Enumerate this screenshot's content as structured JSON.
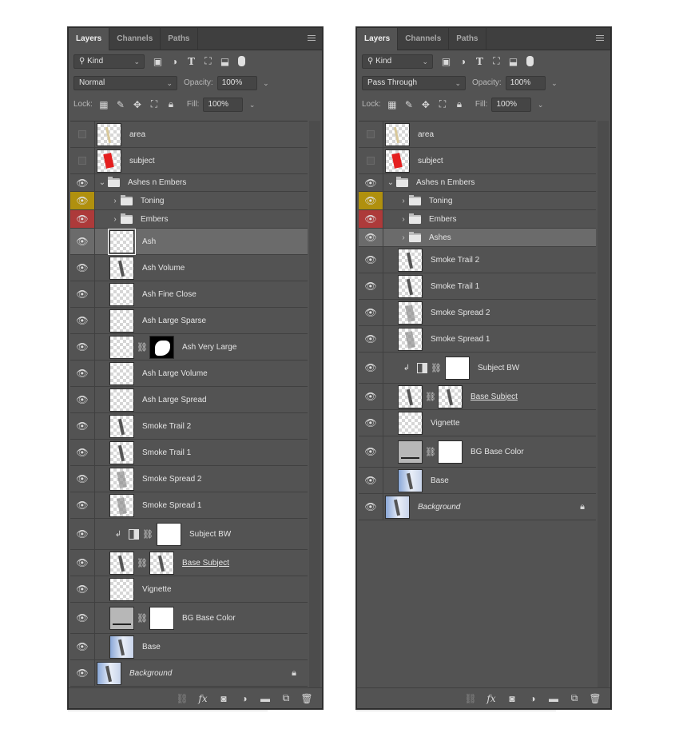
{
  "panels": [
    {
      "id": "left",
      "tabs": [
        "Layers",
        "Channels",
        "Paths"
      ],
      "filter_label": "Kind",
      "blend_mode": "Normal",
      "opacity_label": "Opacity:",
      "opacity_value": "100%",
      "lock_label": "Lock:",
      "fill_label": "Fill:",
      "fill_value": "100%",
      "layers": [
        {
          "name": "area",
          "type": "layer",
          "visible": false,
          "thumb": "tan",
          "indent": 0,
          "h": 33
        },
        {
          "name": "subject",
          "type": "layer",
          "visible": false,
          "thumb": "red",
          "indent": 0,
          "h": 33
        },
        {
          "name": "Ashes n Embers",
          "type": "group-open",
          "visible": true,
          "indent": 0,
          "h": 22
        },
        {
          "name": "Toning",
          "type": "group",
          "visible": true,
          "color": "yellow",
          "indent": 1,
          "h": 23
        },
        {
          "name": "Embers",
          "type": "group",
          "visible": true,
          "color": "red",
          "indent": 1,
          "h": 23
        },
        {
          "name": "Ash",
          "type": "layer",
          "visible": true,
          "thumb": "checker",
          "indent": 1,
          "selected": true,
          "h": 33
        },
        {
          "name": "Ash Volume",
          "type": "layer",
          "visible": true,
          "thumb": "ink",
          "indent": 1,
          "h": 33
        },
        {
          "name": "Ash Fine Close",
          "type": "layer",
          "visible": true,
          "thumb": "checker",
          "indent": 1,
          "h": 33
        },
        {
          "name": "Ash Large Sparse",
          "type": "layer",
          "visible": true,
          "thumb": "checker",
          "indent": 1,
          "h": 33
        },
        {
          "name": "Ash Very Large",
          "type": "masked",
          "visible": true,
          "thumb": "checker",
          "mask": "blob",
          "indent": 1,
          "h": 33
        },
        {
          "name": "Ash Large Volume",
          "type": "layer",
          "visible": true,
          "thumb": "checker",
          "indent": 1,
          "h": 33
        },
        {
          "name": "Ash Large Spread",
          "type": "layer",
          "visible": true,
          "thumb": "checker",
          "indent": 1,
          "h": 33
        },
        {
          "name": "Smoke Trail 2",
          "type": "layer",
          "visible": true,
          "thumb": "ink",
          "indent": 1,
          "h": 33
        },
        {
          "name": "Smoke Trail 1",
          "type": "layer",
          "visible": true,
          "thumb": "ink",
          "indent": 1,
          "h": 33
        },
        {
          "name": "Smoke Spread 2",
          "type": "layer",
          "visible": true,
          "thumb": "smoke",
          "indent": 1,
          "h": 33
        },
        {
          "name": "Smoke Spread 1",
          "type": "layer",
          "visible": true,
          "thumb": "smoke",
          "indent": 1,
          "h": 33
        },
        {
          "name": "Subject BW",
          "type": "adjustment",
          "visible": true,
          "indent": 1,
          "h": 39
        },
        {
          "name": "Base Subject",
          "type": "masked",
          "visible": true,
          "thumb": "ink",
          "mask": "ink",
          "underline": true,
          "indent": 1,
          "h": 33
        },
        {
          "name": "Vignette",
          "type": "layer",
          "visible": true,
          "thumb": "checker",
          "indent": 1,
          "h": 33
        },
        {
          "name": "BG Base Color",
          "type": "masked",
          "visible": true,
          "thumb": "gray",
          "mask": "white",
          "indent": 1,
          "h": 39
        },
        {
          "name": "Base",
          "type": "layer",
          "visible": true,
          "thumb": "photo",
          "indent": 1,
          "h": 33
        },
        {
          "name": "Background",
          "type": "layer",
          "visible": true,
          "thumb": "photo",
          "italic": true,
          "locked": true,
          "indent": 0,
          "h": 33
        }
      ],
      "footer_icons": [
        "link-icon",
        "fx-icon",
        "mask-icon",
        "adjustment-icon",
        "folder-icon",
        "new-layer-icon",
        "trash-icon"
      ]
    },
    {
      "id": "right",
      "tabs": [
        "Layers",
        "Channels",
        "Paths"
      ],
      "filter_label": "Kind",
      "blend_mode": "Pass Through",
      "opacity_label": "Opacity:",
      "opacity_value": "100%",
      "lock_label": "Lock:",
      "fill_label": "Fill:",
      "fill_value": "100%",
      "layers": [
        {
          "name": "area",
          "type": "layer",
          "visible": false,
          "thumb": "tan",
          "indent": 0,
          "h": 33
        },
        {
          "name": "subject",
          "type": "layer",
          "visible": false,
          "thumb": "red",
          "indent": 0,
          "h": 33
        },
        {
          "name": "Ashes n Embers",
          "type": "group-open",
          "visible": true,
          "indent": 0,
          "h": 22
        },
        {
          "name": "Toning",
          "type": "group",
          "visible": true,
          "color": "yellow",
          "indent": 1,
          "h": 23
        },
        {
          "name": "Embers",
          "type": "group",
          "visible": true,
          "color": "red",
          "indent": 1,
          "h": 23
        },
        {
          "name": "Ashes",
          "type": "group",
          "visible": true,
          "indent": 1,
          "selected": true,
          "h": 23
        },
        {
          "name": "Smoke Trail 2",
          "type": "layer",
          "visible": true,
          "thumb": "ink",
          "indent": 1,
          "h": 33
        },
        {
          "name": "Smoke Trail 1",
          "type": "layer",
          "visible": true,
          "thumb": "ink",
          "indent": 1,
          "h": 33
        },
        {
          "name": "Smoke Spread 2",
          "type": "layer",
          "visible": true,
          "thumb": "smoke",
          "indent": 1,
          "h": 33
        },
        {
          "name": "Smoke Spread 1",
          "type": "layer",
          "visible": true,
          "thumb": "smoke",
          "indent": 1,
          "h": 33
        },
        {
          "name": "Subject BW",
          "type": "adjustment",
          "visible": true,
          "indent": 1,
          "h": 39
        },
        {
          "name": "Base Subject",
          "type": "masked",
          "visible": true,
          "thumb": "ink",
          "mask": "ink",
          "underline": true,
          "indent": 1,
          "h": 33
        },
        {
          "name": "Vignette",
          "type": "layer",
          "visible": true,
          "thumb": "checker",
          "indent": 1,
          "h": 33
        },
        {
          "name": "BG Base Color",
          "type": "masked",
          "visible": true,
          "thumb": "gray",
          "mask": "white",
          "indent": 1,
          "h": 39
        },
        {
          "name": "Base",
          "type": "layer",
          "visible": true,
          "thumb": "photo",
          "indent": 1,
          "h": 33
        },
        {
          "name": "Background",
          "type": "layer",
          "visible": true,
          "thumb": "photo",
          "italic": true,
          "locked": true,
          "indent": 0,
          "h": 33
        }
      ],
      "footer_icons": [
        "link-icon",
        "fx-icon",
        "mask-icon",
        "adjustment-icon",
        "folder-icon",
        "new-layer-icon",
        "trash-icon"
      ]
    }
  ],
  "colors": {
    "panel_bg": "#535353",
    "tab_bg": "#3f3f3f",
    "selected_row": "#6b6b6b",
    "label_yellow": "#b0900e",
    "label_red": "#ad3a3a"
  }
}
